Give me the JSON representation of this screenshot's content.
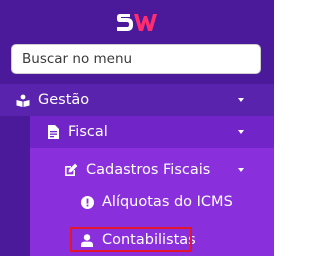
{
  "logo": {
    "text": "SW",
    "colors": {
      "s": "#ffffff",
      "w": "#ff2d6f"
    }
  },
  "search": {
    "placeholder": "Buscar no menu",
    "value": ""
  },
  "menu": {
    "gestao": {
      "label": "Gestão",
      "icon": "book-reader-icon"
    },
    "fiscal": {
      "label": "Fiscal",
      "icon": "file-invoice-icon"
    },
    "cadastros_fiscais": {
      "label": "Cadastros Fiscais",
      "icon": "edit-icon"
    },
    "aliquotas": {
      "label": "Alíquotas do ICMS",
      "icon": "exclamation-circle-icon"
    },
    "contabilistas": {
      "label": "Contabilistas",
      "icon": "user-icon"
    }
  },
  "colors": {
    "sidebar_bg": "#4a1a9a",
    "level0_bg": "#5a23ad",
    "level1_bg": "#7125c8",
    "level2_bg": "#8a2fdc",
    "highlight": "#e3162b"
  }
}
